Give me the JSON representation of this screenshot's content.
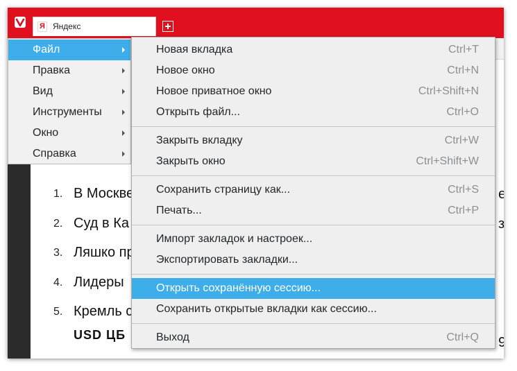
{
  "tab": {
    "title": "Яндекс",
    "favicon_letter": "Я"
  },
  "main_menu": {
    "items": [
      {
        "label": "Файл"
      },
      {
        "label": "Правка"
      },
      {
        "label": "Вид"
      },
      {
        "label": "Инструменты"
      },
      {
        "label": "Окно"
      },
      {
        "label": "Справка"
      }
    ]
  },
  "file_menu": {
    "new_tab": {
      "label": "Новая вкладка",
      "shortcut": "Ctrl+T"
    },
    "new_window": {
      "label": "Новое окно",
      "shortcut": "Ctrl+N"
    },
    "new_private_window": {
      "label": "Новое приватное окно",
      "shortcut": "Ctrl+Shift+N"
    },
    "open_file": {
      "label": "Открыть файл...",
      "shortcut": "Ctrl+O"
    },
    "close_tab": {
      "label": "Закрыть вкладку",
      "shortcut": "Ctrl+W"
    },
    "close_window": {
      "label": "Закрыть окно",
      "shortcut": "Ctrl+Shift+W"
    },
    "save_page": {
      "label": "Сохранить страницу как...",
      "shortcut": "Ctrl+S"
    },
    "print": {
      "label": "Печать...",
      "shortcut": "Ctrl+P"
    },
    "import_bookmarks": {
      "label": "Импорт закладок и настроек..."
    },
    "export_bookmarks": {
      "label": "Экспортировать закладки..."
    },
    "open_session": {
      "label": "Открыть сохранённую сессию..."
    },
    "save_session": {
      "label": "Сохранить открытые вкладки как сессию..."
    },
    "exit": {
      "label": "Выход",
      "shortcut": "Ctrl+Q"
    }
  },
  "page": {
    "news": [
      {
        "num": "1.",
        "text": "В Москве"
      },
      {
        "num": "2.",
        "text": "Суд в Ка"
      },
      {
        "num": "3.",
        "text": "Ляшко пр"
      },
      {
        "num": "4.",
        "text": "Лидеры"
      },
      {
        "num": "5.",
        "text": "Кремль с"
      }
    ],
    "usd_label": "USD ЦБ",
    "right_fragments": [
      "е",
      "з",
      "9"
    ]
  },
  "colors": {
    "titlebar": "#e0101e",
    "menu_highlight": "#3daee9",
    "menu_background": "#efefef"
  }
}
